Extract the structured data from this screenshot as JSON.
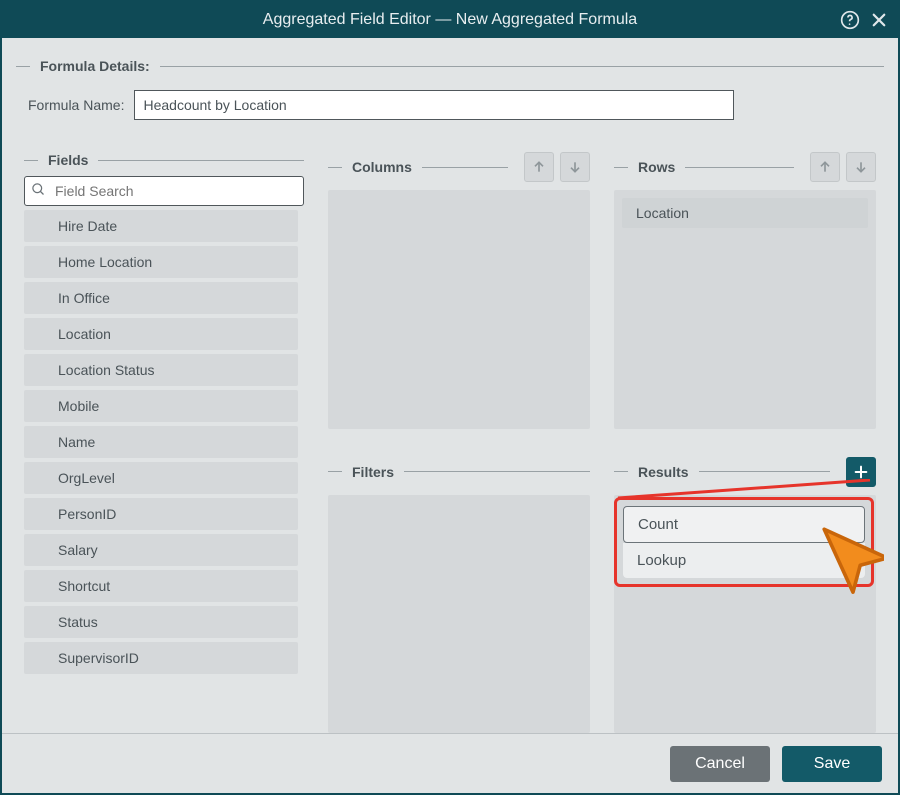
{
  "titlebar": {
    "title": "Aggregated Field Editor — New Aggregated Formula"
  },
  "formula": {
    "section_label": "Formula Details:",
    "name_label": "Formula Name:",
    "name_value": "Headcount by Location"
  },
  "fields": {
    "section_label": "Fields",
    "search_placeholder": "Field Search",
    "items": [
      "Hire Date",
      "Home Location",
      "In Office",
      "Location",
      "Location Status",
      "Mobile",
      "Name",
      "OrgLevel",
      "PersonID",
      "Salary",
      "Shortcut",
      "Status",
      "SupervisorID"
    ]
  },
  "columns": {
    "section_label": "Columns",
    "items": []
  },
  "rows": {
    "section_label": "Rows",
    "items": [
      "Location"
    ]
  },
  "filters": {
    "section_label": "Filters",
    "items": []
  },
  "results": {
    "section_label": "Results",
    "menu": {
      "option1": "Count",
      "option2": "Lookup"
    }
  },
  "footer": {
    "cancel": "Cancel",
    "save": "Save"
  }
}
